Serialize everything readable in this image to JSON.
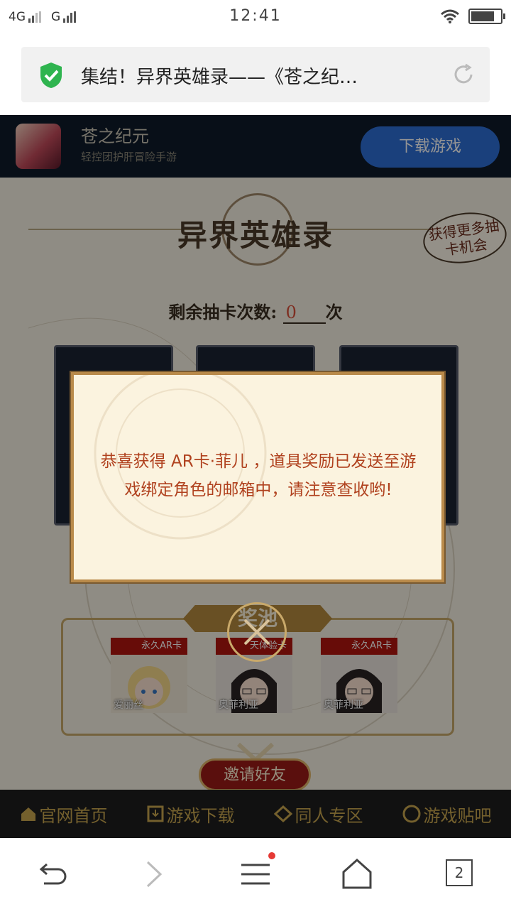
{
  "status_bar": {
    "network_primary": "4G",
    "network_secondary": "G",
    "time": "12:41",
    "battery_level": 0.9
  },
  "url_bar": {
    "title": "集结！异界英雄录——《苍之纪…",
    "secure_icon": "shield-check-icon",
    "reload_icon": "reload-icon"
  },
  "app_banner": {
    "name": "苍之纪元",
    "subtitle": "轻控团护肝冒险手游",
    "download_label": "下载游戏"
  },
  "event": {
    "title": "异界英雄录",
    "bubble": "获得更多抽卡机会",
    "remaining_label": "剩余抽卡次数:",
    "remaining_count": "0",
    "remaining_unit": "次",
    "pool_title": "奖池",
    "pool_cards": [
      {
        "tag": "永久AR卡",
        "name": "爱丽丝"
      },
      {
        "tag": "天体验卡",
        "name": "奥菲利亚"
      },
      {
        "tag": "永久AR卡",
        "name": "奥菲利亚"
      }
    ],
    "invite_label": "邀请好友"
  },
  "footer_nav": [
    {
      "label": "官网首页",
      "icon": "home-icon"
    },
    {
      "label": "游戏下载",
      "icon": "download-icon"
    },
    {
      "label": "同人专区",
      "icon": "fan-icon"
    },
    {
      "label": "游戏贴吧",
      "icon": "forum-icon"
    }
  ],
  "modal": {
    "message": "恭喜获得 AR卡·菲儿 ，道具奖励已发送至游戏绑定角色的邮箱中，请注意查收哟!"
  },
  "browser_bar": {
    "tab_count": "2"
  },
  "colors": {
    "accent_blue": "#2e6fd6",
    "modal_text": "#b0411e",
    "footer_gold": "#c8a64f"
  }
}
